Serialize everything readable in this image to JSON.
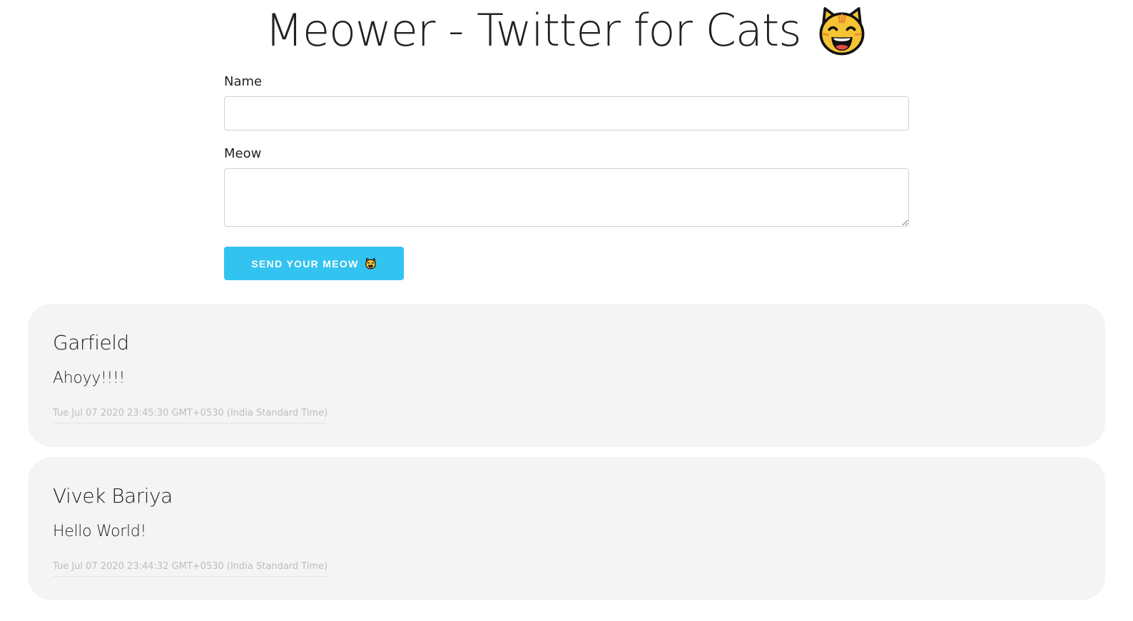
{
  "header": {
    "title": "Meower - Twitter for Cats",
    "title_icon": "grinning-cat-emoji"
  },
  "form": {
    "name_label": "Name",
    "name_value": "",
    "meow_label": "Meow",
    "meow_value": "",
    "send_label": "SEND YOUR MEOW",
    "send_icon": "grinning-cat-emoji"
  },
  "meows": [
    {
      "author": "Garfield",
      "content": "Ahoyy!!!!",
      "date": "Tue Jul 07 2020 23:45:30 GMT+0530 (India Standard Time)"
    },
    {
      "author": "Vivek Bariya",
      "content": "Hello World!",
      "date": "Tue Jul 07 2020 23:44:32 GMT+0530 (India Standard Time)"
    }
  ],
  "colors": {
    "button": "#33c3f0",
    "card_background": "#f4f4f4",
    "date_text": "#bdbdbd"
  }
}
